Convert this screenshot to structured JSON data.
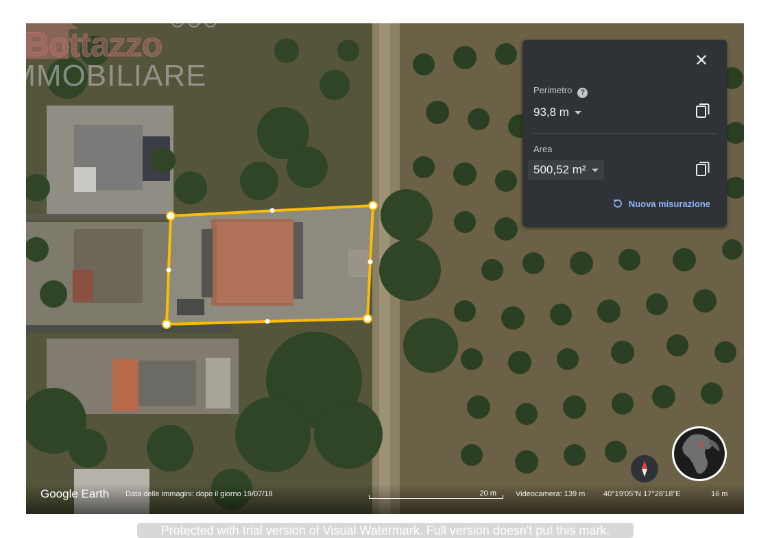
{
  "watermark": {
    "brand": "Bottazzo",
    "subtitle": "IMMOBILIARE",
    "social_icons": [
      "whatsapp-icon",
      "instagram-icon",
      "facebook-icon"
    ]
  },
  "measure_panel": {
    "perimeter_label": "Perimetro",
    "perimeter_value": "93,8 m",
    "area_label": "Area",
    "area_value": "500,52 m²",
    "new_measure_label": "Nuova misurazione",
    "close_icon": "close-icon",
    "copy_icon": "copy-icon",
    "help_icon": "help-icon"
  },
  "status_bar": {
    "brand": "Google Earth",
    "image_date": "Data delle immagini: dopo il giorno 19/07/18",
    "scale_label": "20 m",
    "camera": "Videocamera: 139 m",
    "coordinates": "40°19'05\"N 17°28'18\"E",
    "zoom": "16 m"
  },
  "overlay": {
    "trial_notice": "Protected with trial version of Visual Watermark. Full version doesn't put this mark."
  },
  "colors": {
    "polygon": "#fbbc04",
    "panel_bg": "#2f3337",
    "link": "#8ab4f8"
  }
}
